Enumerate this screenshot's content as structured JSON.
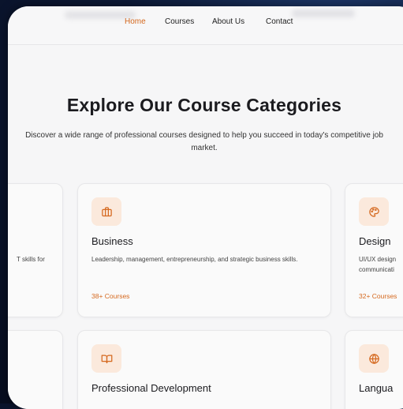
{
  "nav": {
    "links": [
      "Home",
      "Courses",
      "About Us",
      "Contact"
    ],
    "active": "Home"
  },
  "hero": {
    "title": "Explore Our Course Categories",
    "subtitle": "Discover a wide range of professional courses designed to help you succeed in today's competitive job market."
  },
  "cards": {
    "left_partial": {
      "desc_fragment": "T skills for"
    },
    "business": {
      "title": "Business",
      "desc": "Leadership, management, entrepreneurship, and strategic business skills.",
      "count": "38+ Courses",
      "icon": "briefcase-icon"
    },
    "design": {
      "title": "Design",
      "desc_line1": "UI/UX design",
      "desc_line2": "communicati",
      "count": "32+ Courses",
      "icon": "palette-icon"
    },
    "professional": {
      "title": "Professional Development",
      "icon": "book-icon"
    },
    "language": {
      "title": "Langua",
      "icon": "globe-icon"
    }
  },
  "colors": {
    "accent": "#d5691f",
    "icon_bg": "#fbe9dc",
    "page_bg": "#f6f6f7",
    "outer_bg": "#0d1a38"
  }
}
